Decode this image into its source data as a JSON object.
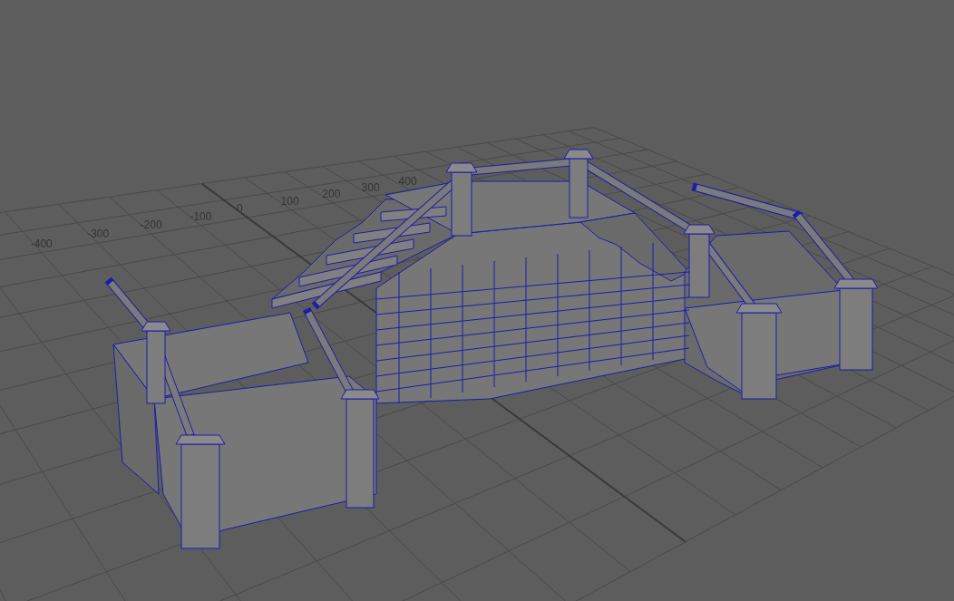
{
  "viewport": {
    "grid_labels": [
      "-400",
      "-300",
      "-200",
      "-100",
      "0",
      "100",
      "200",
      "300",
      "400"
    ]
  }
}
